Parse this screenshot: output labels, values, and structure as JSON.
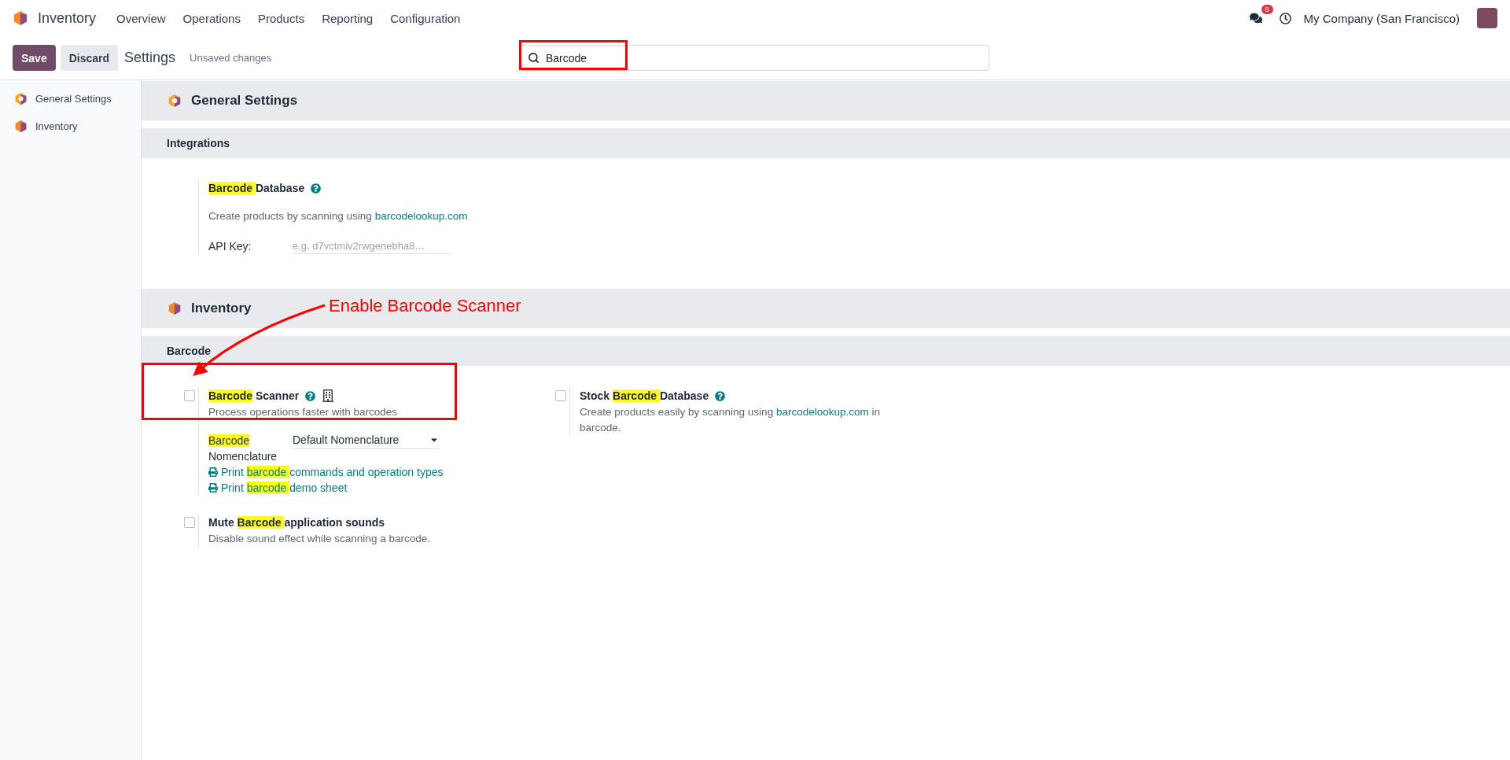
{
  "navbar": {
    "app": "Inventory",
    "menus": [
      "Overview",
      "Operations",
      "Products",
      "Reporting",
      "Configuration"
    ],
    "messages_count": "8",
    "company": "My Company (San Francisco)"
  },
  "control_bar": {
    "save": "Save",
    "discard": "Discard",
    "title": "Settings",
    "status": "Unsaved changes",
    "search": {
      "value": "Barcode"
    }
  },
  "sidebar": {
    "items": [
      {
        "label": "General Settings",
        "kind": "general"
      },
      {
        "label": "Inventory",
        "kind": "inventory"
      }
    ]
  },
  "sections": [
    {
      "title": "General Settings",
      "kind": "general",
      "groups": [
        {
          "title": "Integrations",
          "columns": [
            [
              {
                "kind": "field",
                "title": [
                  {
                    "text": "Barcode ",
                    "highlight": true
                  },
                  {
                    "text": "Database",
                    "highlight": false
                  }
                ],
                "help": true,
                "description": [
                  {
                    "text": "Create products by scanning using ",
                    "link": false
                  },
                  {
                    "text": "barcodelookup.com",
                    "link": true
                  }
                ],
                "field": {
                  "label": "API Key:",
                  "placeholder": "e.g. d7vctmiv2rwgenebha8…"
                }
              }
            ]
          ]
        }
      ]
    },
    {
      "title": "Inventory",
      "kind": "inventory",
      "groups": [
        {
          "title": "Barcode",
          "columns": [
            [
              {
                "kind": "checkbox",
                "checked": false,
                "title": [
                  {
                    "text": "Barcode",
                    "highlight": true
                  },
                  {
                    "text": " Scanner",
                    "highlight": false
                  }
                ],
                "help": true,
                "device_icon": true,
                "description": [
                  {
                    "text": "Process operations faster with barcodes",
                    "link": false
                  }
                ],
                "nomenclature": {
                  "label": [
                    {
                      "text": "Barcode",
                      "highlight": true
                    },
                    {
                      "text": " Nomenclature",
                      "highlight": false
                    }
                  ],
                  "value": "Default Nomenclature"
                },
                "links": [
                  [
                    {
                      "text": "Print ",
                      "highlight": false
                    },
                    {
                      "text": "barcode ",
                      "highlight": true
                    },
                    {
                      "text": "commands and operation types",
                      "highlight": false
                    }
                  ],
                  [
                    {
                      "text": "Print ",
                      "highlight": false
                    },
                    {
                      "text": "barcode ",
                      "highlight": true
                    },
                    {
                      "text": "demo sheet",
                      "highlight": false
                    }
                  ]
                ]
              },
              {
                "kind": "checkbox",
                "checked": false,
                "title": [
                  {
                    "text": "Mute ",
                    "highlight": false
                  },
                  {
                    "text": "Barcode ",
                    "highlight": true
                  },
                  {
                    "text": "application sounds",
                    "highlight": false
                  }
                ],
                "description": [
                  {
                    "text": "Disable sound effect while scanning a barcode.",
                    "link": false
                  }
                ]
              }
            ],
            [
              {
                "kind": "checkbox",
                "checked": false,
                "title": [
                  {
                    "text": "Stock ",
                    "highlight": false
                  },
                  {
                    "text": "Barcode ",
                    "highlight": true
                  },
                  {
                    "text": "Database",
                    "highlight": false
                  }
                ],
                "help": true,
                "description": [
                  {
                    "text": "Create products easily by scanning using ",
                    "link": false
                  },
                  {
                    "text": "barcodelookup.com",
                    "link": true
                  },
                  {
                    "text": " in barcode.",
                    "link": false
                  }
                ]
              }
            ]
          ]
        }
      ]
    }
  ],
  "annotation": {
    "text": "Enable Barcode Scanner"
  }
}
